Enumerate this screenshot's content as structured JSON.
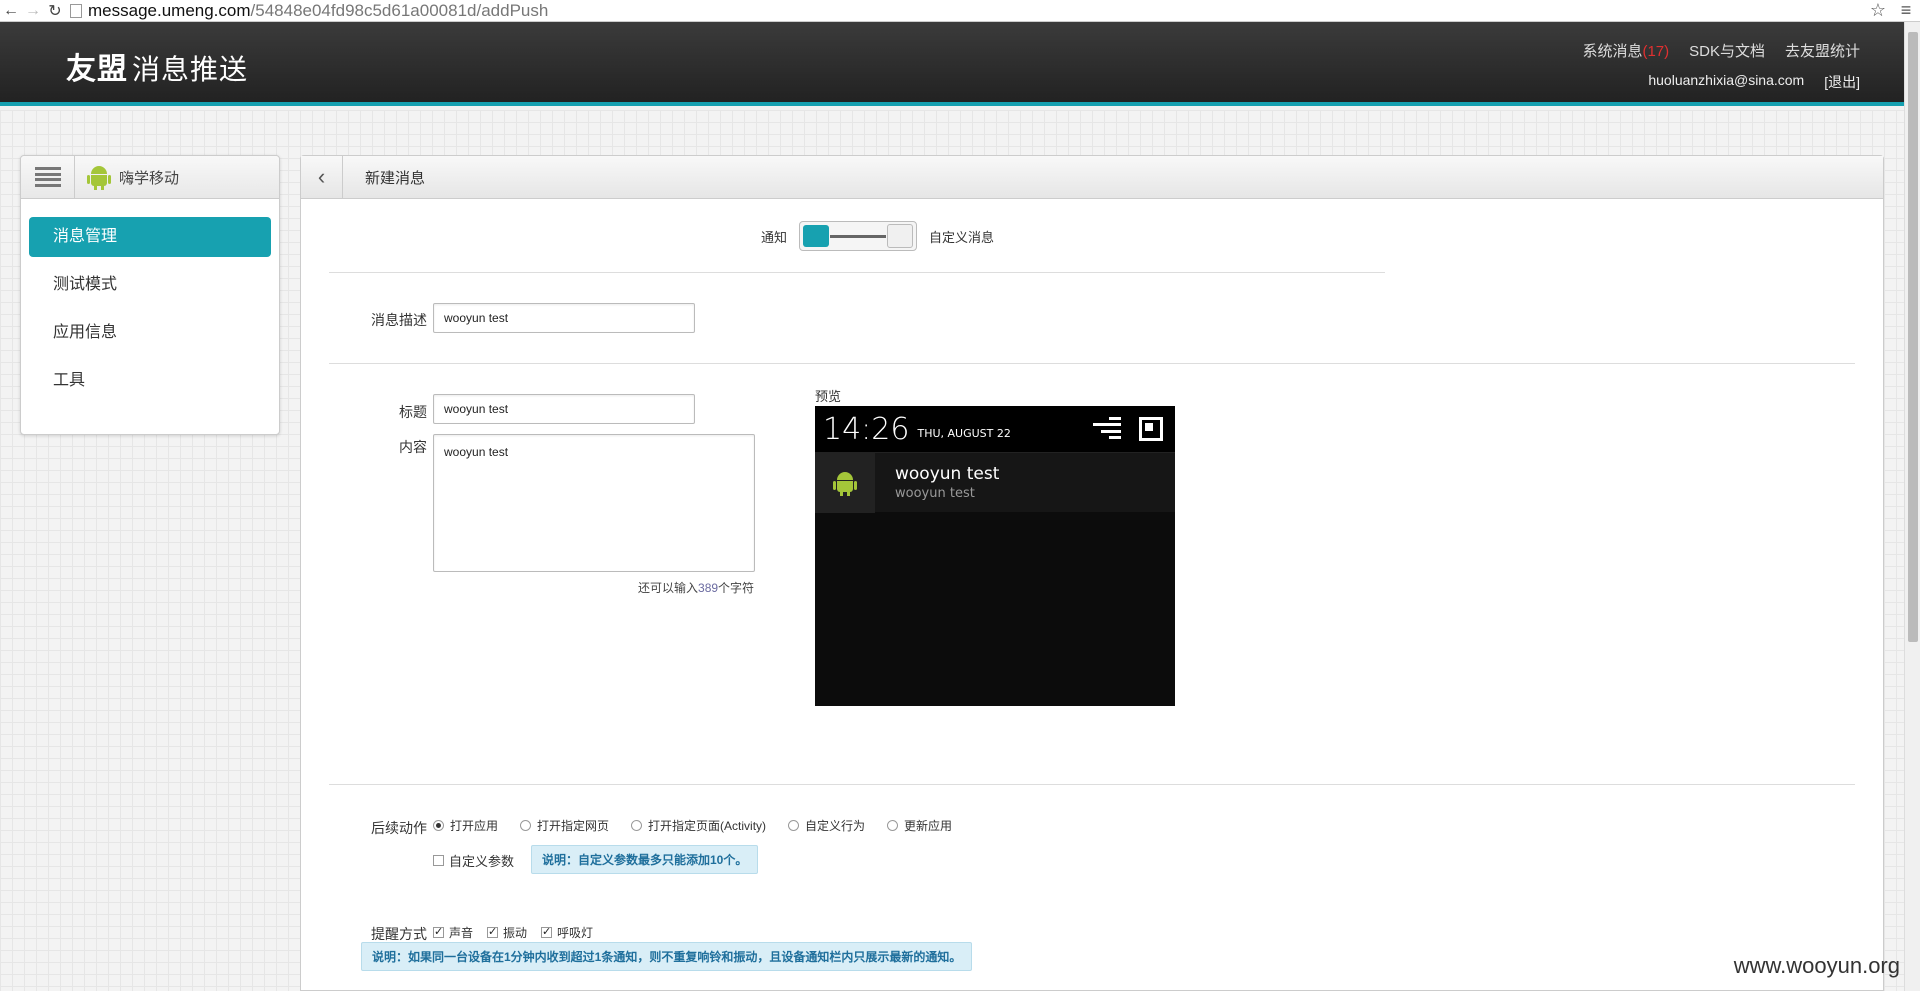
{
  "browser": {
    "url_host": "message.umeng.com",
    "url_path": "/54848e04fd98c5d61a00081d/addPush"
  },
  "header": {
    "logo_main": "友盟",
    "logo_sub": "消息推送",
    "links": {
      "system_messages": "系统消息",
      "system_messages_count": "(17)",
      "sdk_docs": "SDK与文档",
      "go_stats": "去友盟统计"
    },
    "user_email": "huoluanzhixia@sina.com",
    "logout": "[退出]"
  },
  "sidebar": {
    "app_name": "嗨学移动",
    "items": [
      {
        "label": "消息管理"
      },
      {
        "label": "测试模式"
      },
      {
        "label": "应用信息"
      },
      {
        "label": "工具"
      }
    ]
  },
  "main": {
    "title": "新建消息",
    "toggle": {
      "left_label": "通知",
      "right_label": "自定义消息"
    },
    "description": {
      "label": "消息描述",
      "value": "wooyun test"
    },
    "title_field": {
      "label": "标题",
      "value": "wooyun test"
    },
    "content_field": {
      "label": "内容",
      "value": "wooyun test"
    },
    "char_count": {
      "prefix": "还可以输入",
      "number": "389",
      "suffix": "个字符"
    },
    "preview": {
      "label": "预览",
      "time": "14:26",
      "date": "THU, AUGUST 22",
      "notif_title": "wooyun test",
      "notif_text": "wooyun test"
    },
    "actions": {
      "label": "后续动作",
      "options": [
        "打开应用",
        "打开指定网页",
        "打开指定页面(Activity)",
        "自定义行为",
        "更新应用"
      ],
      "custom_param": "自定义参数",
      "custom_note": "说明：自定义参数最多只能添加10个。"
    },
    "reminder": {
      "label": "提醒方式",
      "options": [
        "声音",
        "振动",
        "呼吸灯"
      ],
      "note": "说明：如果同一台设备在1分钟内收到超过1条通知，则不重复响铃和振动，且设备通知栏内只展示最新的通知。"
    }
  },
  "watermark": "www.wooyun.org"
}
